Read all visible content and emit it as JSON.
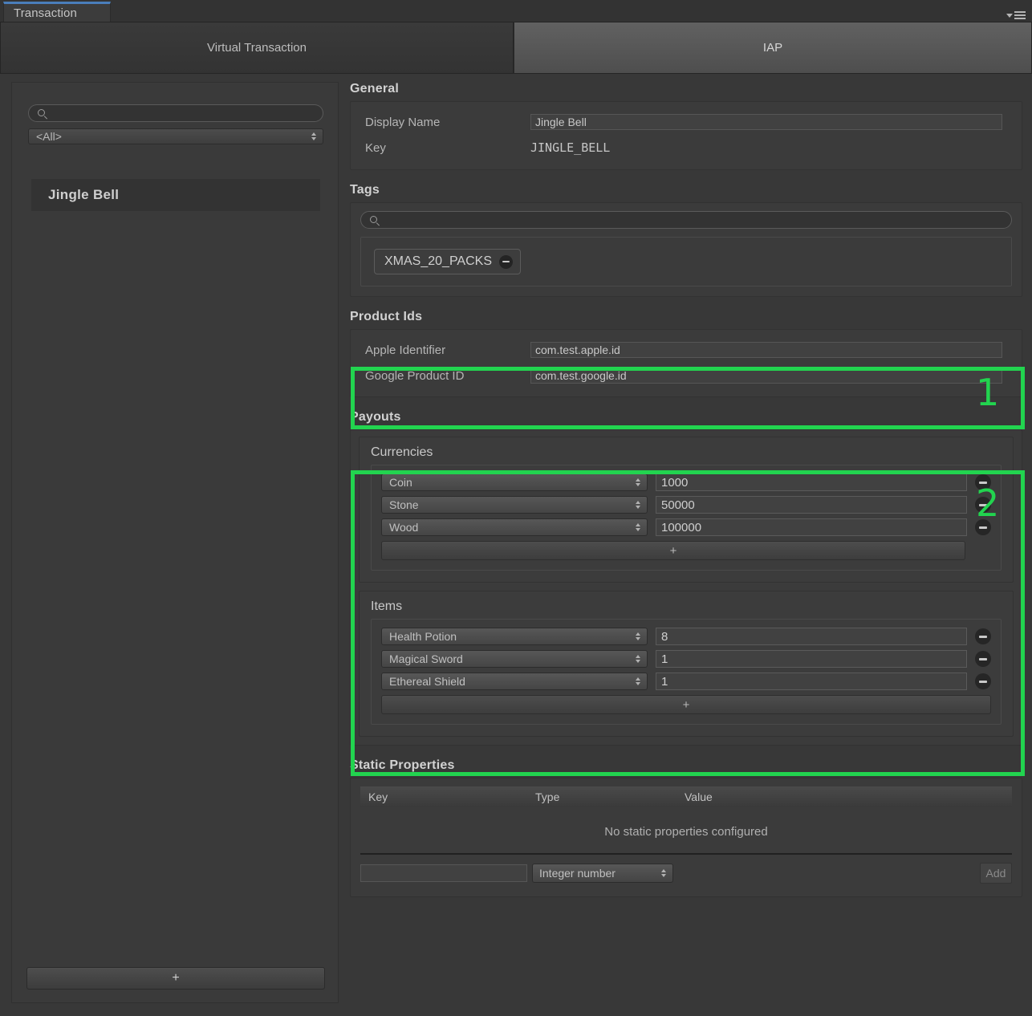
{
  "window": {
    "tab_handle_label": "Transaction",
    "menu_icon": "hamburger-menu-icon",
    "caret_icon": "chevron-down-icon"
  },
  "tabs": [
    {
      "label": "Virtual Transaction",
      "active": false
    },
    {
      "label": "IAP",
      "active": true
    }
  ],
  "sidebar": {
    "search_placeholder": "",
    "search_value": "",
    "search_icon": "search-icon",
    "filter_value": "<All>",
    "items": [
      {
        "label": "Jingle Bell"
      }
    ],
    "add_label": "+"
  },
  "general": {
    "title": "General",
    "display_name_label": "Display Name",
    "display_name_value": "Jingle Bell",
    "key_label": "Key",
    "key_value": "JINGLE_BELL"
  },
  "tags": {
    "title": "Tags",
    "search_value": "",
    "search_icon": "search-icon",
    "chips": [
      {
        "label": "XMAS_20_PACKS"
      }
    ]
  },
  "product_ids": {
    "title": "Product Ids",
    "apple_label": "Apple Identifier",
    "apple_value": "com.test.apple.id",
    "google_label": "Google Product ID",
    "google_value": "com.test.google.id"
  },
  "payouts": {
    "title": "Payouts",
    "currencies": {
      "label": "Currencies",
      "rows": [
        {
          "name": "Coin",
          "amount": "1000"
        },
        {
          "name": "Stone",
          "amount": "50000"
        },
        {
          "name": "Wood",
          "amount": "100000"
        }
      ],
      "add_label": "+"
    },
    "items": {
      "label": "Items",
      "rows": [
        {
          "name": "Health Potion",
          "amount": "8"
        },
        {
          "name": "Magical Sword",
          "amount": "1"
        },
        {
          "name": "Ethereal Shield",
          "amount": "1"
        }
      ],
      "add_label": "+"
    }
  },
  "static_properties": {
    "title": "Static Properties",
    "columns": [
      "Key",
      "Type",
      "Value"
    ],
    "empty_message": "No static properties configured",
    "new_key_value": "",
    "new_type_value": "Integer number",
    "add_label": "Add"
  },
  "annotations": [
    {
      "number": "1",
      "target": "product-ids-panel"
    },
    {
      "number": "2",
      "target": "payouts-panel"
    }
  ],
  "colors": {
    "annotation_green": "#22d44f",
    "tab_accent_blue": "#4a7ebb"
  }
}
